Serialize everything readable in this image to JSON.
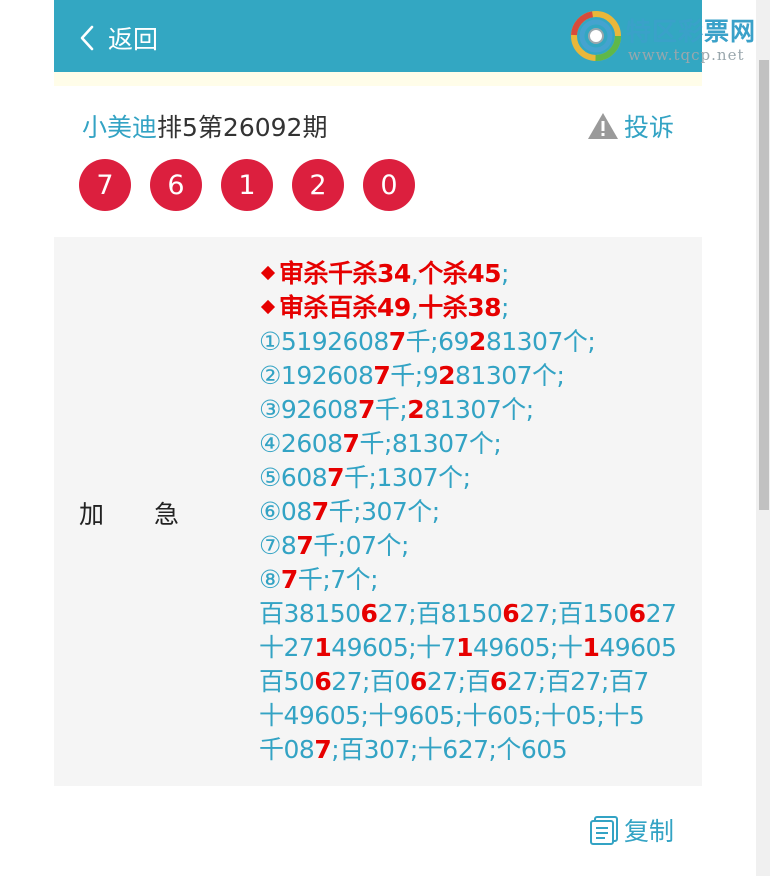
{
  "header": {
    "back_label": "返回",
    "logo_text": "特区彩票网",
    "logo_url": "www.tqcp.net"
  },
  "title": {
    "expert": "小美迪",
    "rest": "排5第26092期",
    "complain": "投诉"
  },
  "balls": [
    "7",
    "6",
    "1",
    "2",
    "0"
  ],
  "label": "加急",
  "content": {
    "kill1": {
      "a": "审杀千杀34",
      "sep": ",",
      "b": "个杀45",
      "end": ";"
    },
    "kill2": {
      "a": "审杀百杀49",
      "sep": ",",
      "b": "十杀38",
      "end": ";"
    },
    "lines": [
      [
        [
          "①5192608",
          0
        ],
        [
          "7",
          1
        ],
        [
          "千;69",
          0
        ],
        [
          "2",
          1
        ],
        [
          "81307个;",
          0
        ]
      ],
      [
        [
          "②192608",
          0
        ],
        [
          "7",
          1
        ],
        [
          "千;9",
          0
        ],
        [
          "2",
          1
        ],
        [
          "81307个;",
          0
        ]
      ],
      [
        [
          "③92608",
          0
        ],
        [
          "7",
          1
        ],
        [
          "千;",
          0
        ],
        [
          "2",
          1
        ],
        [
          "81307个;",
          0
        ]
      ],
      [
        [
          "④2608",
          0
        ],
        [
          "7",
          1
        ],
        [
          "千;81307个;",
          0
        ]
      ],
      [
        [
          "⑤608",
          0
        ],
        [
          "7",
          1
        ],
        [
          "千;1307个;",
          0
        ]
      ],
      [
        [
          "⑥08",
          0
        ],
        [
          "7",
          1
        ],
        [
          "千;307个;",
          0
        ]
      ],
      [
        [
          "⑦8",
          0
        ],
        [
          "7",
          1
        ],
        [
          "千;07个;",
          0
        ]
      ],
      [
        [
          "⑧",
          0
        ],
        [
          "7",
          1
        ],
        [
          "千;7个;",
          0
        ]
      ],
      [
        [
          "百38150",
          0
        ],
        [
          "6",
          1
        ],
        [
          "27;百8150",
          0
        ],
        [
          "6",
          1
        ],
        [
          "27;百150",
          0
        ],
        [
          "6",
          1
        ],
        [
          "27",
          0
        ]
      ],
      [
        [
          "十27",
          0
        ],
        [
          "1",
          1
        ],
        [
          "49605;十7",
          0
        ],
        [
          "1",
          1
        ],
        [
          "49605;十",
          0
        ],
        [
          "1",
          1
        ],
        [
          "49605",
          0
        ]
      ],
      [
        [
          "百50",
          0
        ],
        [
          "6",
          1
        ],
        [
          "27;百0",
          0
        ],
        [
          "6",
          1
        ],
        [
          "27;百",
          0
        ],
        [
          "6",
          1
        ],
        [
          "27;百27;百7",
          0
        ]
      ],
      [
        [
          "十49605;十9605;十605;十05;十5",
          0
        ]
      ],
      [
        [
          "千08",
          0
        ],
        [
          "7",
          1
        ],
        [
          ";百307;十627;个605",
          0
        ]
      ]
    ]
  },
  "copy_label": "复制",
  "colors": {
    "header": "#33a7c2",
    "ball": "#dc1f3e",
    "accent": "#33a3c4",
    "highlight": "#e60000"
  }
}
